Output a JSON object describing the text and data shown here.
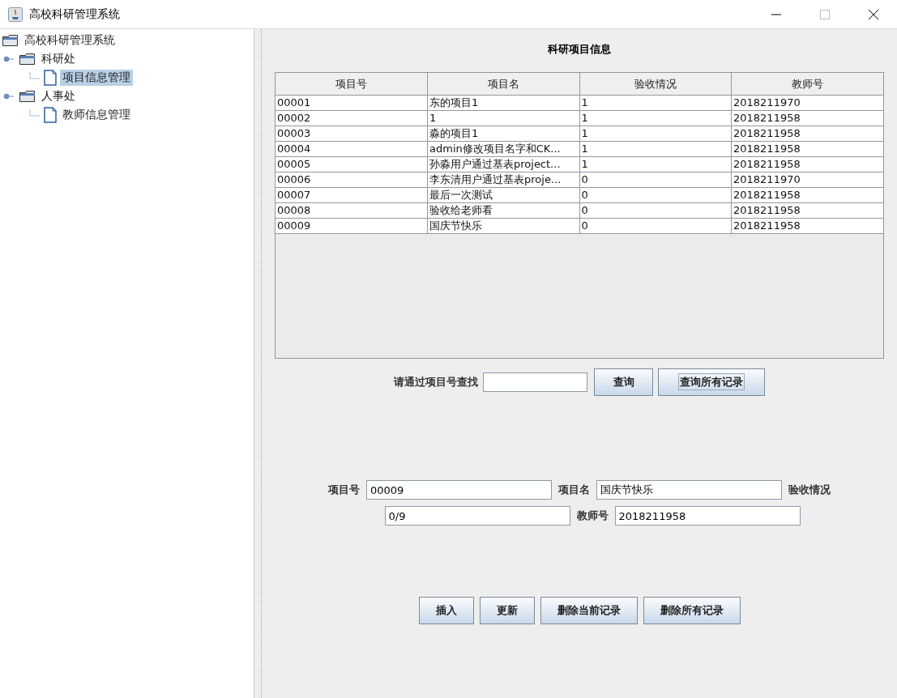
{
  "window": {
    "title": "高校科研管理系统"
  },
  "tree": {
    "label": "高校科研管理系统",
    "expanded": true,
    "children": [
      {
        "label": "科研处",
        "expanded": true,
        "children": [
          {
            "label": "项目信息管理",
            "selected": true
          }
        ]
      },
      {
        "label": "人事处",
        "expanded": true,
        "children": [
          {
            "label": "教师信息管理",
            "selected": false
          }
        ]
      }
    ]
  },
  "heading": "科研项目信息",
  "table": {
    "columns": [
      "项目号",
      "项目名",
      "验收情况",
      "教师号"
    ],
    "rows": [
      [
        "00001",
        "东的项目1",
        "1",
        "2018211970"
      ],
      [
        "00002",
        "1",
        "1",
        "2018211958"
      ],
      [
        "00003",
        "淼的项目1",
        "1",
        "2018211958"
      ],
      [
        "00004",
        "admin修改项目名字和CK...",
        "1",
        "2018211958"
      ],
      [
        "00005",
        "孙淼用户通过基表project...",
        "1",
        "2018211958"
      ],
      [
        "00006",
        "李东清用户通过基表proje...",
        "0",
        "2018211970"
      ],
      [
        "00007",
        "最后一次测试",
        "0",
        "2018211958"
      ],
      [
        "00008",
        "验收给老师看",
        "0",
        "2018211958"
      ],
      [
        "00009",
        "国庆节快乐",
        "0",
        "2018211958"
      ]
    ]
  },
  "search": {
    "label": "请通过项目号查找",
    "buttons": [
      {
        "label": "查询",
        "focused": false
      },
      {
        "label": "查询所有记录",
        "focused": true
      }
    ]
  },
  "form": {
    "project_id": {
      "label": "项目号",
      "value": "00009"
    },
    "project_name": {
      "label": "项目名",
      "value": "国庆节快乐"
    },
    "acceptance": {
      "label": "验收情况",
      "value": "0/9"
    },
    "teacher_id": {
      "label": "教师号",
      "value": "2018211958"
    }
  },
  "buttons": [
    "插入",
    "更新",
    "删除当前记录",
    "删除所有记录"
  ]
}
